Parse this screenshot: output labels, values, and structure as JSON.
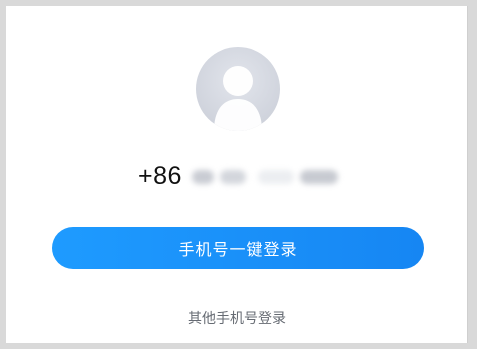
{
  "login": {
    "country_code": "+86",
    "one_click_button_label": "手机号一键登录",
    "other_phone_login_label": "其他手机号登录"
  },
  "colors": {
    "accent": "#1686f3",
    "avatar_bg": "#d4d8e0",
    "secondary_text": "#666b73"
  },
  "icons": {
    "avatar": "default-user-avatar-icon"
  }
}
